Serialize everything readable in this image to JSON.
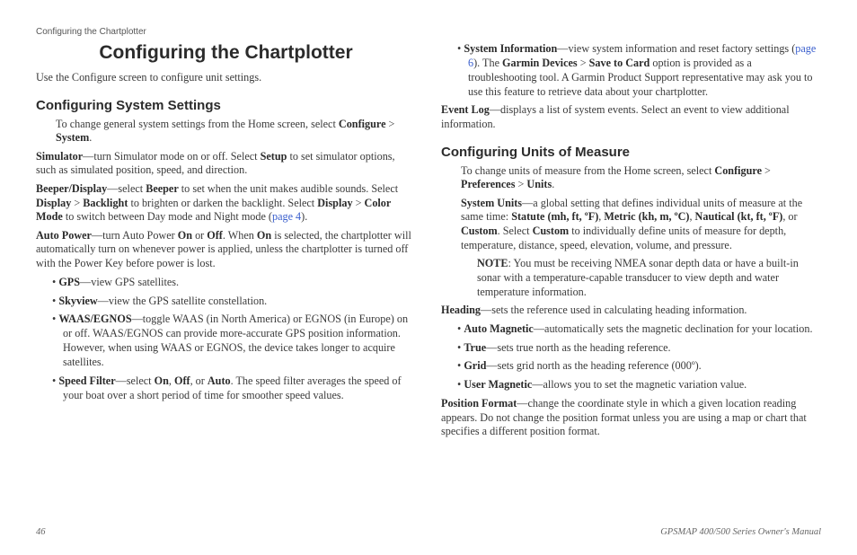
{
  "runningHeader": "Configuring the Chartplotter",
  "title": "Configuring the Chartplotter",
  "intro": "Use the Configure screen to configure unit settings.",
  "left": {
    "h2a": "Configuring System Settings",
    "p1a": "To change general system settings from the Home screen, select ",
    "p1b": "Configure",
    "p1c": " > ",
    "p1d": "System",
    "p1e": ".",
    "p2a": "Simulator",
    "p2b": "—turn Simulator mode on or off. Select ",
    "p2c": "Setup",
    "p2d": " to set simulator options, such as simulated position, speed, and direction.",
    "p3a": "Beeper/Display",
    "p3b": "—select ",
    "p3c": "Beeper",
    "p3d": " to set when the unit makes audible sounds. Select ",
    "p3e": "Display",
    "p3f": " > ",
    "p3g": "Backlight",
    "p3h": " to brighten or darken the backlight. Select ",
    "p3i": "Display",
    "p3j": " > ",
    "p3k": "Color Mode",
    "p3l": " to switch between Day mode and Night mode (",
    "p3link": "page 4",
    "p3m": ").",
    "p4a": "Auto Power",
    "p4b": "—turn Auto Power ",
    "p4c": "On",
    "p4d": " or ",
    "p4e": "Off",
    "p4f": ". When ",
    "p4g": "On",
    "p4h": " is selected, the chartplotter will automatically turn on whenever power is applied, unless the chartplotter is turned off with the Power Key before power is lost.",
    "li1a": "GPS",
    "li1b": "—view GPS satellites.",
    "li2a": "Skyview",
    "li2b": "—view the GPS satellite constellation.",
    "li3a": "WAAS/EGNOS",
    "li3b": "—toggle WAAS (in North America) or EGNOS (in Europe) on or off. WAAS/EGNOS can provide more-accurate GPS position information. However, when using WAAS or EGNOS, the device takes longer to acquire satellites.",
    "li4a": "Speed Filter",
    "li4b": "—select ",
    "li4c": "On",
    "li4d": ", ",
    "li4e": "Off",
    "li4f": ", or ",
    "li4g": "Auto",
    "li4h": ". The speed filter averages the speed of your boat over a short period of time for smoother speed values."
  },
  "right": {
    "li1a": "System Information",
    "li1b": "—view system information and reset factory settings (",
    "li1link": "page 6",
    "li1c": "). The ",
    "li1d": "Garmin Devices",
    "li1e": " > ",
    "li1f": "Save to Card",
    "li1g": " option is provided as a troubleshooting tool. A Garmin Product Support representative may ask you to use this feature to retrieve data about your chartplotter.",
    "p1a": "Event Log",
    "p1b": "—displays a list of system events. Select an event to view additional information.",
    "h2a": "Configuring Units of Measure",
    "p2a": "To change units of measure from the Home screen, select ",
    "p2b": "Configure",
    "p2c": " > ",
    "p2d": "Preferences",
    "p2e": " > ",
    "p2f": "Units",
    "p2g": ".",
    "p3a": "System Units",
    "p3b": "—a global setting that defines individual units of measure at the same time: ",
    "p3c": "Statute (mh, ft, ºF)",
    "p3d": ", ",
    "p3e": "Metric (kh, m, ºC)",
    "p3f": ", ",
    "p3g": "Nautical (kt, ft, ºF)",
    "p3h": ", or ",
    "p3i": "Custom",
    "p3j": ". Select ",
    "p3k": "Custom",
    "p3l": " to individually define units of measure for depth, temperature, distance, speed, elevation, volume, and pressure.",
    "noteA": "NOTE",
    "noteB": ": You must be receiving NMEA sonar depth data or have a built-in sonar with a temperature-capable transducer to view depth and water temperature information.",
    "p4a": "Heading",
    "p4b": "—sets the reference used in calculating heading information.",
    "li2a": "Auto Magnetic",
    "li2b": "—automatically sets the magnetic declination for your location.",
    "li3a": "True",
    "li3b": "—sets true north as the heading reference.",
    "li4a": "Grid",
    "li4b": "—sets grid north as the heading reference (000º).",
    "li5a": "User Magnetic",
    "li5b": "—allows you to set the magnetic variation value.",
    "p5a": "Position Format",
    "p5b": "—change the coordinate style in which a given location reading appears. Do not change the position format unless you are using a map or chart that specifies a different position format."
  },
  "footer": {
    "page": "46",
    "manual": "GPSMAP 400/500 Series Owner's Manual"
  }
}
